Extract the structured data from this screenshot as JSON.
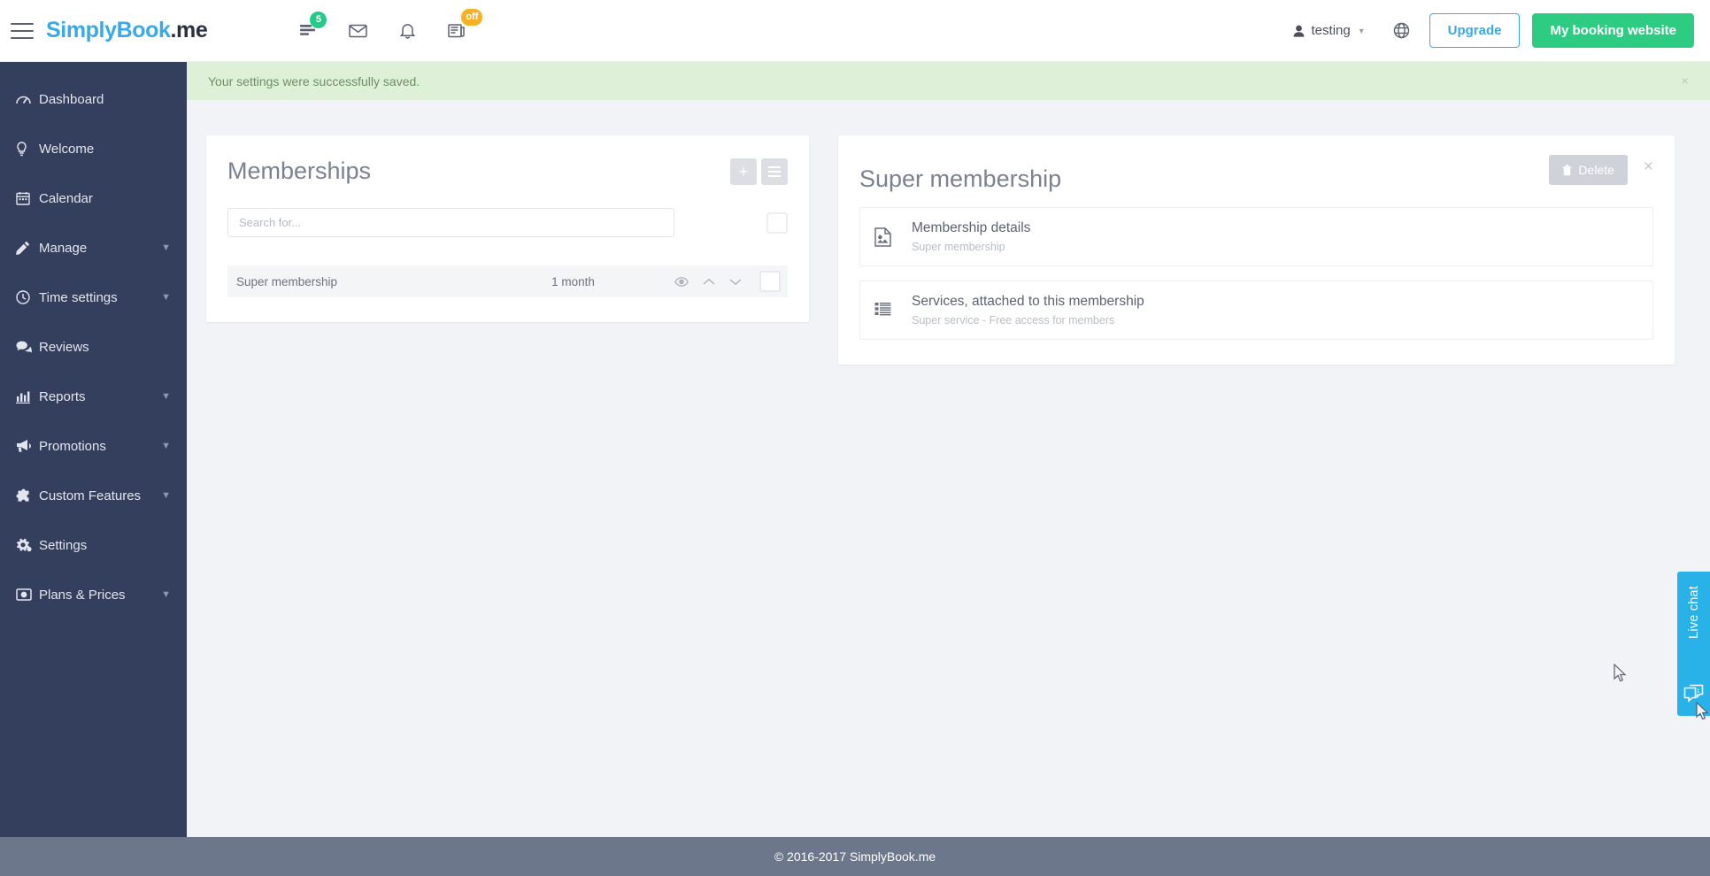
{
  "header": {
    "logo_prefix": "SimplyBook",
    "logo_suffix": ".me",
    "icons": [
      {
        "name": "activity-icon",
        "badge": "5"
      },
      {
        "name": "mail-icon",
        "badge": ""
      },
      {
        "name": "bell-icon",
        "badge": ""
      },
      {
        "name": "news-icon",
        "badge": "off"
      }
    ],
    "user_name": "testing",
    "upgrade_label": "Upgrade",
    "booking_label": "My booking website"
  },
  "sidebar": {
    "items": [
      {
        "label": "Dashboard",
        "icon": "dashboard-icon",
        "caret": false
      },
      {
        "label": "Welcome",
        "icon": "bulb-icon",
        "caret": false
      },
      {
        "label": "Calendar",
        "icon": "calendar-icon",
        "caret": false
      },
      {
        "label": "Manage",
        "icon": "pencil-icon",
        "caret": true
      },
      {
        "label": "Time settings",
        "icon": "clock-icon",
        "caret": true
      },
      {
        "label": "Reviews",
        "icon": "comments-icon",
        "caret": false
      },
      {
        "label": "Reports",
        "icon": "chart-icon",
        "caret": true
      },
      {
        "label": "Promotions",
        "icon": "megaphone-icon",
        "caret": true
      },
      {
        "label": "Custom Features",
        "icon": "puzzle-icon",
        "caret": true
      },
      {
        "label": "Settings",
        "icon": "gears-icon",
        "caret": false
      },
      {
        "label": "Plans & Prices",
        "icon": "card-icon",
        "caret": true
      }
    ]
  },
  "alert": {
    "message": "Your settings were successfully saved.",
    "close": "×"
  },
  "memberships_panel": {
    "title": "Memberships",
    "add_label": "+",
    "search_placeholder": "Search for...",
    "search_value": "",
    "rows": [
      {
        "name": "Super membership",
        "period": "1 month"
      }
    ]
  },
  "detail_panel": {
    "title": "Super membership",
    "delete_label": "Delete",
    "close": "×",
    "items": [
      {
        "title": "Membership details",
        "subtitle": "Super membership",
        "icon": "image-file-icon"
      },
      {
        "title": "Services, attached to this membership",
        "subtitle": "Super service - Free access for members",
        "icon": "list-icon"
      }
    ]
  },
  "livechat": {
    "label": "Live chat"
  },
  "footer": {
    "text": "© 2016-2017 SimplyBook.me"
  }
}
